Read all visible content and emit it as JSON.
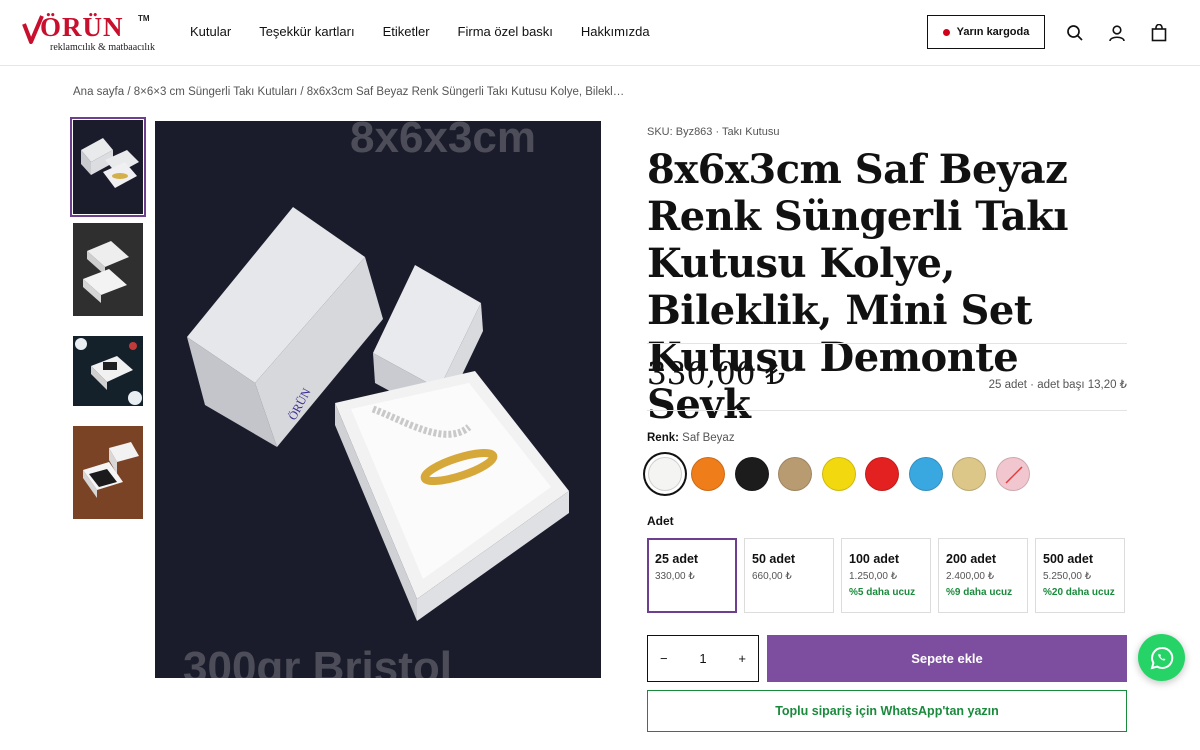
{
  "brand": {
    "name": "ÖRÜN",
    "tm": "TM",
    "tagline": "reklamcılık & matbaacılık"
  },
  "nav": {
    "items": [
      "Kutular",
      "Teşekkür kartları",
      "Etiketler",
      "Firma özel baskı",
      "Hakkımızda"
    ]
  },
  "header": {
    "cargo_label": "Yarın kargoda",
    "icons": [
      "search-icon",
      "user-icon",
      "bag-icon"
    ]
  },
  "breadcrumb": "Ana sayfa / 8×6×3 cm Süngerli Takı Kutuları / 8x6x3cm Saf Beyaz Renk Süngerli Takı Kutusu Kolye, Bilekl…",
  "gallery": {
    "watermark_top": "8x6x3cm",
    "watermark_bottom": "300gr Bristol",
    "thumb_count": 4
  },
  "product": {
    "sku": "SKU: Byz863 · Takı Kutusu",
    "title": "8x6x3cm Saf Beyaz Renk Süngerli Takı Kutusu Kolye, Bileklik, Mini Set Kutusu Demonte Sevk",
    "price": "330,00 ₺",
    "per_unit": "25 adet · adet başı 13,20 ₺"
  },
  "color": {
    "label": "Renk:",
    "selected": "Saf Beyaz",
    "swatches": [
      "#f4f4f2",
      "#ef7d1a",
      "#1c1c1c",
      "#b99b72",
      "#f2d90f",
      "#e32121",
      "#3aa8e0",
      "#dcc789",
      "#f2c6cf"
    ]
  },
  "quantity": {
    "label": "Adet",
    "tiers": [
      {
        "qty": "25 adet",
        "price": "330,00 ₺",
        "discount": ""
      },
      {
        "qty": "50 adet",
        "price": "660,00 ₺",
        "discount": ""
      },
      {
        "qty": "100 adet",
        "price": "1.250,00 ₺",
        "discount": "%5 daha ucuz"
      },
      {
        "qty": "200 adet",
        "price": "2.400,00 ₺",
        "discount": "%9 daha ucuz"
      },
      {
        "qty": "500 adet",
        "price": "5.250,00 ₺",
        "discount": "%20 daha ucuz"
      }
    ]
  },
  "cart": {
    "minus": "−",
    "value": "1",
    "plus": "+",
    "add_label": "Sepete ekle",
    "whatsapp_label": "Toplu sipariş için WhatsApp'tan yazın"
  },
  "colors": {
    "accent": "#7d4e9f",
    "brand_red": "#c8102e",
    "whatsapp_green": "#25d366",
    "discount_green": "#1a8a3c"
  }
}
